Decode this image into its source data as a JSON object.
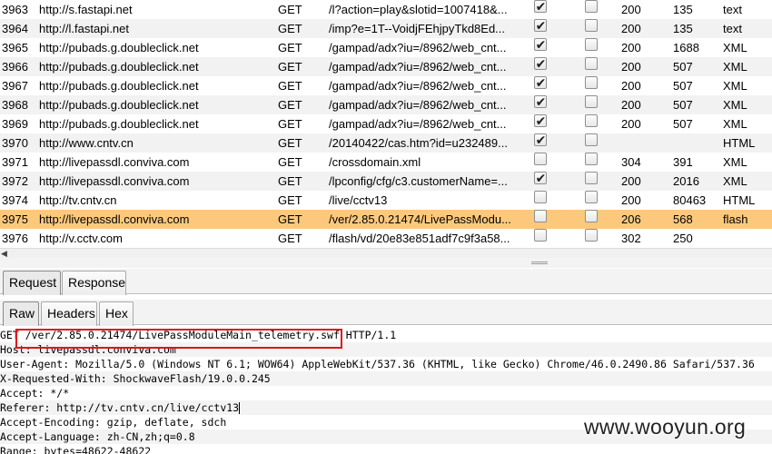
{
  "history": {
    "rows": [
      {
        "num": "3963",
        "host": "http://s.fastapi.net",
        "method": "GET",
        "url": "/l?action=play&slotid=1007418&...",
        "checked1": true,
        "checked2": false,
        "status": "200",
        "length": "135",
        "mime": "text"
      },
      {
        "num": "3964",
        "host": "http://l.fastapi.net",
        "method": "GET",
        "url": "/imp?e=1T--VoidjFEhjpyTkd8Ed...",
        "checked1": true,
        "checked2": false,
        "status": "200",
        "length": "135",
        "mime": "text"
      },
      {
        "num": "3965",
        "host": "http://pubads.g.doubleclick.net",
        "method": "GET",
        "url": "/gampad/adx?iu=/8962/web_cnt...",
        "checked1": true,
        "checked2": false,
        "status": "200",
        "length": "1688",
        "mime": "XML"
      },
      {
        "num": "3966",
        "host": "http://pubads.g.doubleclick.net",
        "method": "GET",
        "url": "/gampad/adx?iu=/8962/web_cnt...",
        "checked1": true,
        "checked2": false,
        "status": "200",
        "length": "507",
        "mime": "XML"
      },
      {
        "num": "3967",
        "host": "http://pubads.g.doubleclick.net",
        "method": "GET",
        "url": "/gampad/adx?iu=/8962/web_cnt...",
        "checked1": true,
        "checked2": false,
        "status": "200",
        "length": "507",
        "mime": "XML"
      },
      {
        "num": "3968",
        "host": "http://pubads.g.doubleclick.net",
        "method": "GET",
        "url": "/gampad/adx?iu=/8962/web_cnt...",
        "checked1": true,
        "checked2": false,
        "status": "200",
        "length": "507",
        "mime": "XML"
      },
      {
        "num": "3969",
        "host": "http://pubads.g.doubleclick.net",
        "method": "GET",
        "url": "/gampad/adx?iu=/8962/web_cnt...",
        "checked1": true,
        "checked2": false,
        "status": "200",
        "length": "507",
        "mime": "XML"
      },
      {
        "num": "3970",
        "host": "http://www.cntv.cn",
        "method": "GET",
        "url": "/20140422/cas.htm?id=u232489...",
        "checked1": true,
        "checked2": false,
        "status": "",
        "length": "",
        "mime": "HTML"
      },
      {
        "num": "3971",
        "host": "http://livepassdl.conviva.com",
        "method": "GET",
        "url": "/crossdomain.xml",
        "checked1": false,
        "checked2": false,
        "status": "304",
        "length": "391",
        "mime": "XML"
      },
      {
        "num": "3972",
        "host": "http://livepassdl.conviva.com",
        "method": "GET",
        "url": "/lpconfig/cfg/c3.customerName=...",
        "checked1": true,
        "checked2": false,
        "status": "200",
        "length": "2016",
        "mime": "XML"
      },
      {
        "num": "3974",
        "host": "http://tv.cntv.cn",
        "method": "GET",
        "url": "/live/cctv13",
        "checked1": false,
        "checked2": false,
        "status": "200",
        "length": "80463",
        "mime": "HTML"
      },
      {
        "num": "3975",
        "host": "http://livepassdl.conviva.com",
        "method": "GET",
        "url": "/ver/2.85.0.21474/LivePassModu...",
        "checked1": false,
        "checked2": false,
        "status": "206",
        "length": "568",
        "mime": "flash",
        "selected": true
      },
      {
        "num": "3976",
        "host": "http://v.cctv.com",
        "method": "GET",
        "url": "/flash/vd/20e83e851adf7c9f3a58...",
        "checked1": false,
        "checked2": false,
        "status": "302",
        "length": "250",
        "mime": ""
      }
    ]
  },
  "tabs": {
    "main": [
      {
        "label": "Request",
        "active": true
      },
      {
        "label": "Response",
        "active": false
      }
    ],
    "sub": [
      {
        "label": "Raw",
        "active": true
      },
      {
        "label": "Headers",
        "active": false
      },
      {
        "label": "Hex",
        "active": false
      }
    ]
  },
  "raw_request": {
    "lines": [
      "GET /ver/2.85.0.21474/LivePassModuleMain_telemetry.swf HTTP/1.1",
      "Host: livepassdl.conviva.com",
      "User-Agent: Mozilla/5.0 (Windows NT 6.1; WOW64) AppleWebKit/537.36 (KHTML, like Gecko) Chrome/46.0.2490.86 Safari/537.36",
      "X-Requested-With: ShockwaveFlash/19.0.0.245",
      "Accept: */*",
      "Referer: http://tv.cntv.cn/live/cctv13",
      "Accept-Encoding: gzip, deflate, sdch",
      "Accept-Language: zh-CN,zh;q=0.8",
      "Range: bytes=48622-48622"
    ]
  },
  "watermark": "www.wooyun.org",
  "colors": {
    "selected_row": "#fcc97c",
    "highlight_box": "#e0141a"
  }
}
